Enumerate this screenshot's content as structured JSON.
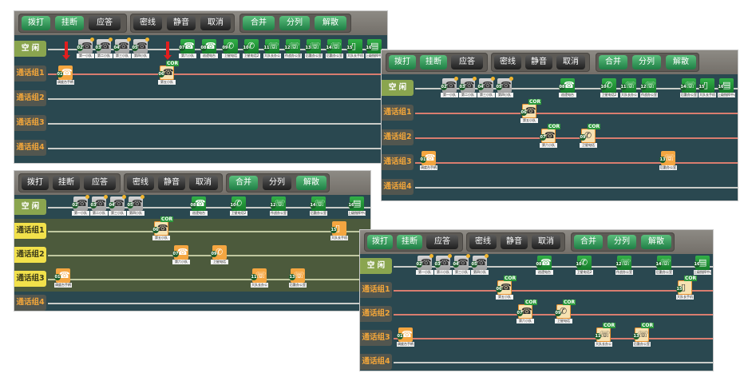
{
  "toolbar": {
    "btn_dial": "拨打",
    "btn_hangup": "挂断",
    "btn_answer": "应答",
    "btn_private": "密线",
    "btn_mute": "静音",
    "btn_cancel": "取消",
    "btn_merge": "合并",
    "btn_split": "分列",
    "btn_dismiss": "解散"
  },
  "rows": {
    "idle": "空 闲",
    "g1": "通话组1",
    "g2": "通话组2",
    "g3": "通话组3",
    "g4": "通话组4"
  },
  "node_labels": {
    "n01": "调度台手柄",
    "n02": "第一小队",
    "n03": "第二小队",
    "n04": "第三小队",
    "n05": "第四小队",
    "n06": "第五小队",
    "n07": "第六小队",
    "n08": "巡逻电台",
    "n09": "卫星电话",
    "n10": "卫星电话2",
    "n11": "大队长办公",
    "n12": "作战办公室",
    "n13": "后勤办公室",
    "n14": "后勤办公室",
    "n15": "大队长手机",
    "n16": "上级指挥中心"
  },
  "badge": {
    "cor": "COR"
  },
  "colors": {
    "panel_bg": "#2a4850",
    "button_green": "#2a8f4e",
    "group_label": "#f1a53a",
    "active_group": "#f2e14b"
  }
}
